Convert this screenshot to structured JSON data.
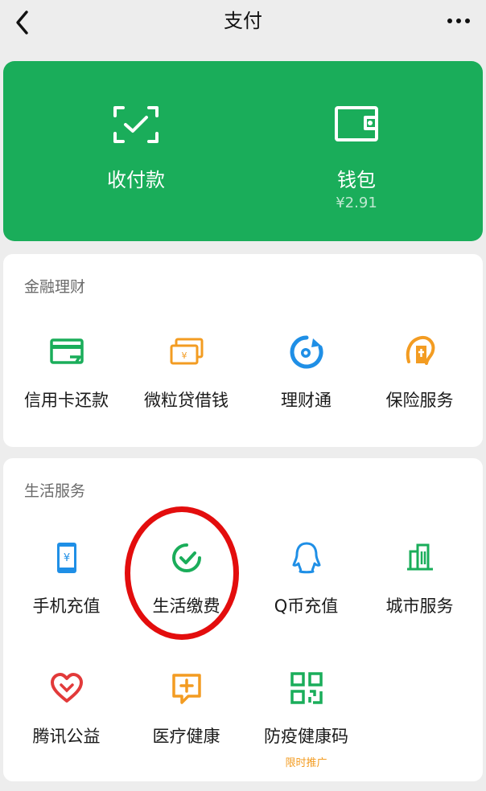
{
  "header": {
    "title": "支付"
  },
  "hero": {
    "collect_label": "收付款",
    "wallet_label": "钱包",
    "wallet_balance": "¥2.91"
  },
  "finance": {
    "title": "金融理财",
    "items": [
      {
        "label": "信用卡还款",
        "icon": "credit-card-icon"
      },
      {
        "label": "微粒贷借钱",
        "icon": "loan-icon"
      },
      {
        "label": "理财通",
        "icon": "wealth-icon"
      },
      {
        "label": "保险服务",
        "icon": "insurance-icon"
      }
    ]
  },
  "life": {
    "title": "生活服务",
    "items": [
      {
        "label": "手机充值",
        "icon": "phone-topup-icon"
      },
      {
        "label": "生活缴费",
        "icon": "utility-payment-icon"
      },
      {
        "label": "Q币充值",
        "icon": "qq-coin-icon"
      },
      {
        "label": "城市服务",
        "icon": "city-service-icon"
      },
      {
        "label": "腾讯公益",
        "icon": "charity-icon"
      },
      {
        "label": "医疗健康",
        "icon": "medical-icon"
      },
      {
        "label": "防疫健康码",
        "icon": "health-code-icon"
      }
    ],
    "promo_label": "限时推广"
  },
  "colors": {
    "brand_green": "#1aad5a",
    "accent_orange": "#f39c22",
    "accent_blue": "#1f8fe6",
    "annotation_red": "#e30d0d"
  }
}
